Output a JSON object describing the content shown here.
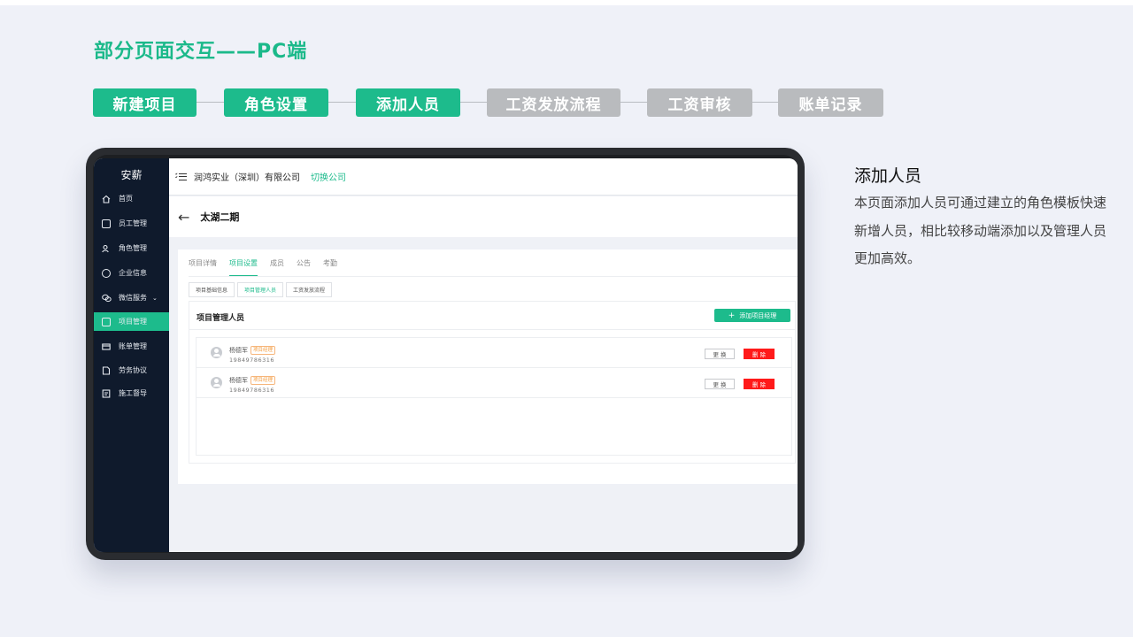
{
  "headline": "部分页面交互——PC端",
  "steps": [
    {
      "label": "新建项目",
      "state": "active"
    },
    {
      "label": "角色设置",
      "state": "active"
    },
    {
      "label": "添加人员",
      "state": "active"
    },
    {
      "label": "工资发放流程",
      "state": "inactive"
    },
    {
      "label": "工资审核",
      "state": "inactive"
    },
    {
      "label": "账单记录",
      "state": "inactive"
    }
  ],
  "colors": {
    "accent": "#1dbb8c",
    "inactive_step": "#b9bbbe",
    "sidebar": "#0f1a2c",
    "danger": "#ff1a1a"
  },
  "app": {
    "brand": "安薪",
    "sidebar": [
      {
        "label": "首页",
        "icon": "home-icon"
      },
      {
        "label": "员工管理",
        "icon": "employee-icon"
      },
      {
        "label": "角色管理",
        "icon": "role-icon"
      },
      {
        "label": "企业信息",
        "icon": "info-icon"
      },
      {
        "label": "微信服务",
        "icon": "wechat-icon"
      },
      {
        "label": "项目管理",
        "icon": "project-icon"
      },
      {
        "label": "账单管理",
        "icon": "bill-icon"
      },
      {
        "label": "劳务协议",
        "icon": "agreement-icon"
      },
      {
        "label": "施工督导",
        "icon": "supervision-icon"
      }
    ],
    "topbar": {
      "company": "润鸿实业（深圳）有限公司",
      "switch": "切换公司"
    },
    "page_title": "太湖二期",
    "tabs": [
      "项目详情",
      "项目设置",
      "成员",
      "公告",
      "考勤"
    ],
    "subtabs": [
      "项目基础信息",
      "项目管理人员",
      "工资发放流程"
    ],
    "panel": {
      "title": "项目管理人员",
      "add_button": "添加项目经理",
      "people": [
        {
          "name": "杨德军",
          "tag": "项目经理",
          "phone": "19849786316",
          "replace": "更 换",
          "delete": "删 除"
        },
        {
          "name": "杨德军",
          "tag": "项目经理",
          "phone": "19849786316",
          "replace": "更 换",
          "delete": "删 除"
        }
      ]
    }
  },
  "description": {
    "title": "添加人员",
    "text": "本页面添加人员可通过建立的角色模板快速新增人员，相比较移动端添加以及管理人员更加高效。"
  }
}
